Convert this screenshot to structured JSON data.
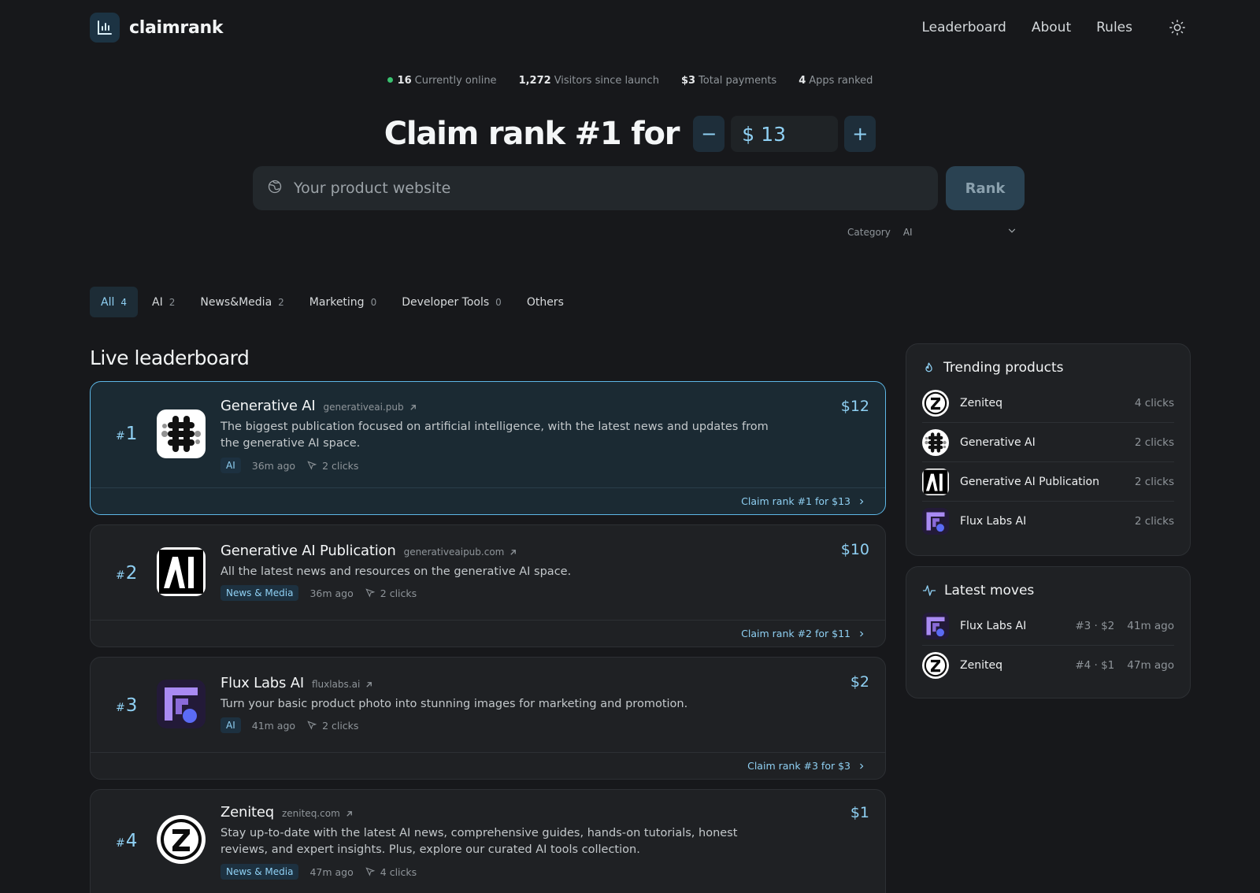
{
  "brand": {
    "name": "claimrank"
  },
  "nav": {
    "items": [
      "Leaderboard",
      "About",
      "Rules"
    ]
  },
  "stats": [
    {
      "value": "16",
      "label": "Currently online"
    },
    {
      "value": "1,272",
      "label": "Visitors since launch"
    },
    {
      "value": "$3",
      "label": "Total payments"
    },
    {
      "value": "4",
      "label": "Apps ranked"
    }
  ],
  "hero": {
    "title": "Claim rank #1 for",
    "currency": "$",
    "amount": "13",
    "minus": "−",
    "plus": "+",
    "placeholder": "Your product website",
    "rank_label": "Rank"
  },
  "category": {
    "label": "Category",
    "value": "AI"
  },
  "tabs": [
    {
      "label": "All",
      "count": "4"
    },
    {
      "label": "AI",
      "count": "2"
    },
    {
      "label": "News&Media",
      "count": "2"
    },
    {
      "label": "Marketing",
      "count": "0"
    },
    {
      "label": "Developer Tools",
      "count": "0"
    },
    {
      "label": "Others",
      "count": ""
    }
  ],
  "section_title": "Live leaderboard",
  "leaderboard": [
    {
      "rank": "1",
      "name": "Generative AI",
      "url": "generativeai.pub",
      "desc": "The biggest publication focused on artificial intelligence, with the latest news and updates from the generative AI space.",
      "tag": "AI",
      "time": "36m ago",
      "clicks": "2 clicks",
      "price": "$12",
      "claim": "Claim rank #1 for $13"
    },
    {
      "rank": "2",
      "name": "Generative AI Publication",
      "url": "generativeaipub.com",
      "desc": "All the latest news and resources on the generative AI space.",
      "tag": "News & Media",
      "time": "36m ago",
      "clicks": "2 clicks",
      "price": "$10",
      "claim": "Claim rank #2 for $11"
    },
    {
      "rank": "3",
      "name": "Flux Labs AI",
      "url": "fluxlabs.ai",
      "desc": "Turn your basic product photo into stunning images for marketing and promotion.",
      "tag": "AI",
      "time": "41m ago",
      "clicks": "2 clicks",
      "price": "$2",
      "claim": "Claim rank #3 for $3"
    },
    {
      "rank": "4",
      "name": "Zeniteq",
      "url": "zeniteq.com",
      "desc": "Stay up-to-date with the latest AI news, comprehensive guides, hands-on tutorials, honest reviews, and expert insights. Plus, explore our curated AI tools collection.",
      "tag": "News & Media",
      "time": "47m ago",
      "clicks": "4 clicks",
      "price": "$1",
      "claim": ""
    }
  ],
  "trending": {
    "title": "Trending products",
    "items": [
      {
        "name": "Zeniteq",
        "value": "4 clicks"
      },
      {
        "name": "Generative AI",
        "value": "2 clicks"
      },
      {
        "name": "Generative AI Publication",
        "value": "2 clicks"
      },
      {
        "name": "Flux Labs AI",
        "value": "2 clicks"
      }
    ]
  },
  "latest": {
    "title": "Latest moves",
    "items": [
      {
        "name": "Flux Labs AI",
        "move": "#3 · $2",
        "time": "41m ago"
      },
      {
        "name": "Zeniteq",
        "move": "#4 · $1",
        "time": "47m ago"
      }
    ]
  },
  "colors": {
    "accent": "#8fd0f3",
    "background": "#17181b",
    "card": "#1f2124",
    "online": "#39c16f"
  }
}
